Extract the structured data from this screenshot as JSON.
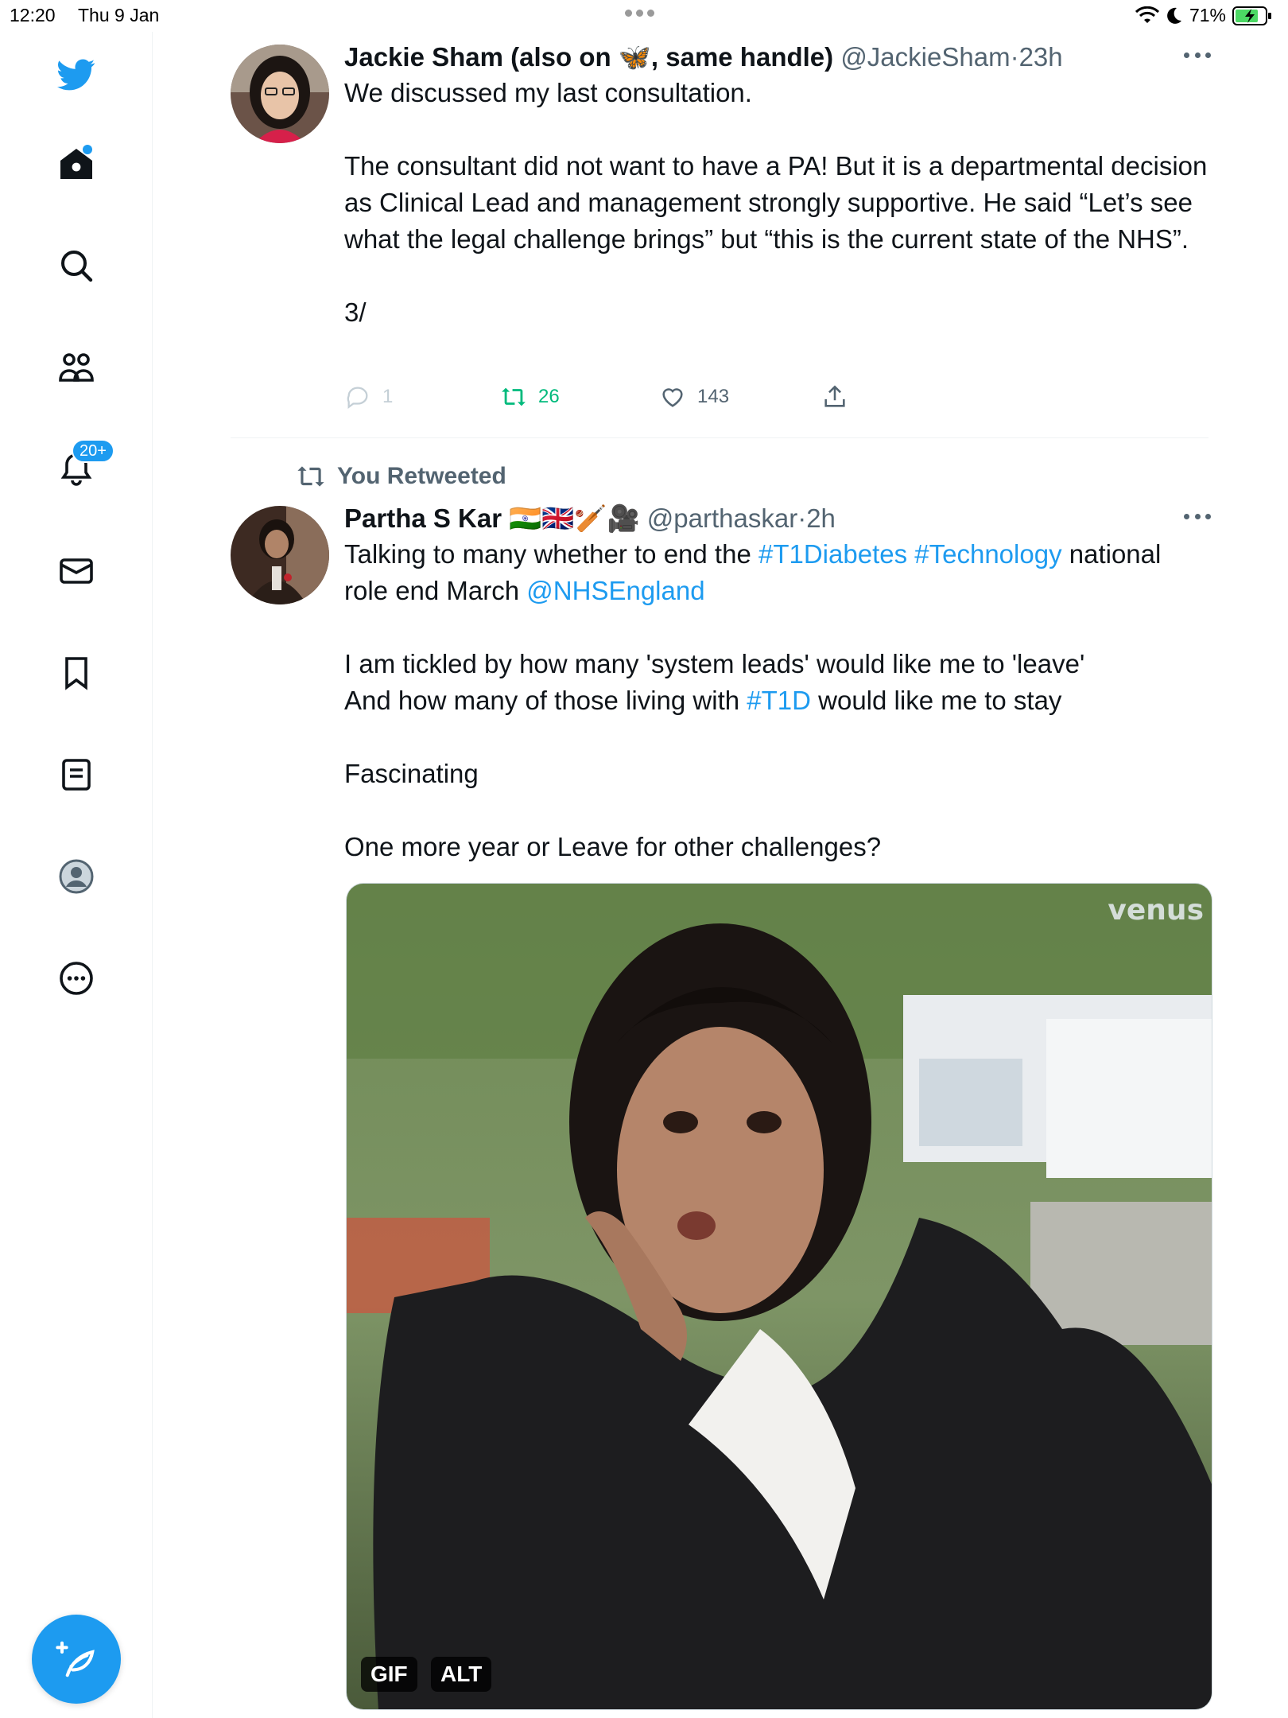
{
  "status_bar": {
    "time": "12:20",
    "date": "Thu 9 Jan",
    "battery": "71%"
  },
  "sidebar": {
    "notifications_badge": "20+"
  },
  "tweets": [
    {
      "name": "Jackie Sham (also on 🦋, same handle)",
      "handle": "@JackieSham",
      "separator": "·",
      "time": "23h",
      "text": "We discussed my last consultation.\n\nThe consultant did not want to have a PA! But it is a departmental decision as Clinical Lead and management strongly supportive. He said “Let’s see what the legal challenge brings” but “this is the current state of the NHS”.\n\n3/",
      "replies": "1",
      "retweets": "26",
      "likes": "143"
    },
    {
      "retweeted_label": "You Retweeted",
      "name": "Partha S Kar 🇮🇳🇬🇧🏏🎥",
      "handle": "@parthaskar",
      "separator": "·",
      "time": "2h",
      "text_parts": {
        "p1": "Talking to many whether to end the ",
        "tag1": "#T1Diabetes",
        "sp1": " ",
        "tag2": "#Technology",
        "p2": " national role end March ",
        "mention": "@NHSEngland",
        "p3": "\n\nI am tickled by how many 'system leads' would like me to 'leave'\nAnd how many of those living with ",
        "tag3": "#T1D",
        "p4": " would like me to stay\n\nFascinating\n\nOne more year or Leave for other challenges?"
      },
      "media": {
        "gif_label": "GIF",
        "alt_label": "ALT",
        "watermark": "venus"
      }
    }
  ],
  "colors": {
    "accent": "#1d9bf0",
    "retweet_green": "#00ba7c",
    "muted": "#536471"
  }
}
